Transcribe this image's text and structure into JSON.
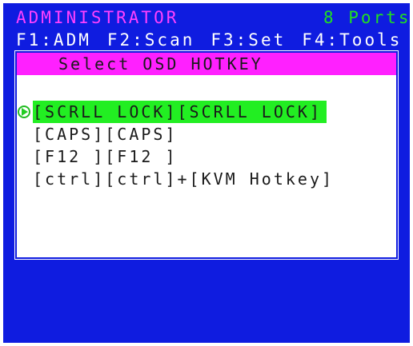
{
  "header": {
    "title": "ADMINISTRATOR",
    "ports": "8 Ports"
  },
  "fkeys": [
    "F1:ADM",
    "F2:Scan",
    "F3:Set",
    "F4:Tools"
  ],
  "dialog": {
    "title": "Select OSD HOTKEY",
    "options": [
      "[SCRLL LOCK][SCRLL LOCK]",
      "[CAPS][CAPS]",
      "[F12 ][F12 ]",
      "[ctrl][ctrl]+[KVM Hotkey]"
    ],
    "selected_index": 0
  },
  "colors": {
    "screen_bg": "#0f1ce0",
    "title_color": "#ff40ff",
    "ports_color": "#20e020",
    "dialog_title_bg": "#ff20ff",
    "selection_bg": "#22ee22"
  },
  "icons": {
    "cursor": "triangle-pointer-icon"
  }
}
